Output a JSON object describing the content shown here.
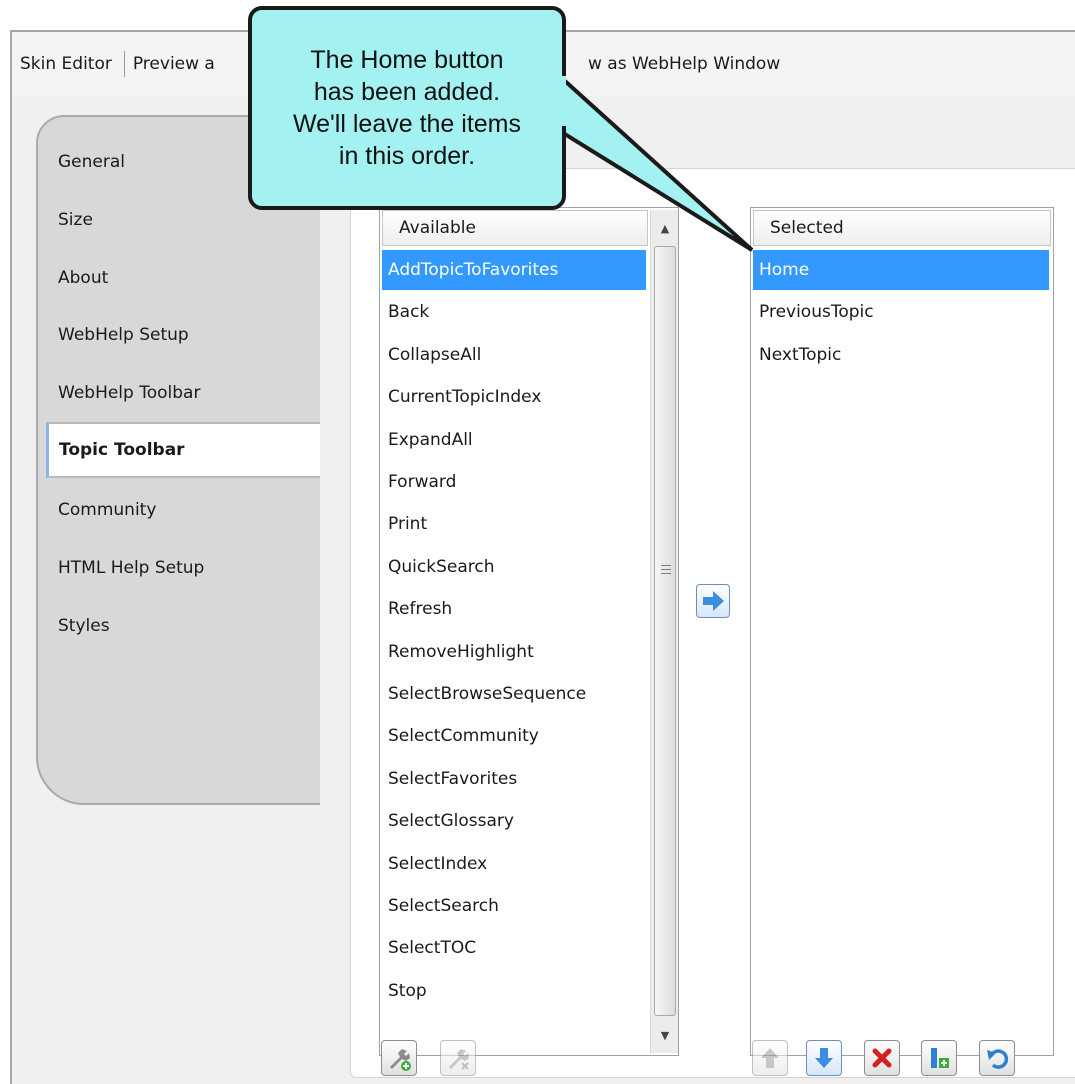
{
  "toolbar": {
    "skin_editor_label": "Skin Editor",
    "preview_label": "Preview a",
    "preview_window_label": "w as WebHelp Window"
  },
  "tabs": [
    {
      "label": "General"
    },
    {
      "label": "Size"
    },
    {
      "label": "About"
    },
    {
      "label": "WebHelp Setup"
    },
    {
      "label": "WebHelp Toolbar"
    },
    {
      "label": "Topic Toolbar",
      "active": true
    },
    {
      "label": "Community"
    },
    {
      "label": "HTML Help Setup"
    },
    {
      "label": "Styles"
    }
  ],
  "available": {
    "header": "Available",
    "items": [
      "AddTopicToFavorites",
      "Back",
      "CollapseAll",
      "CurrentTopicIndex",
      "ExpandAll",
      "Forward",
      "Print",
      "QuickSearch",
      "Refresh",
      "RemoveHighlight",
      "SelectBrowseSequence",
      "SelectCommunity",
      "SelectFavorites",
      "SelectGlossary",
      "SelectIndex",
      "SelectSearch",
      "SelectTOC",
      "Stop"
    ],
    "selected_index": 0
  },
  "selected": {
    "header": "Selected",
    "items": [
      "Home",
      "PreviousTopic",
      "NextTopic"
    ],
    "selected_index": 0
  },
  "icons": {
    "add_arrow": "right-arrow-icon",
    "new_item": "wrench-add-icon",
    "remove_item": "wrench-remove-icon",
    "move_up": "arrow-up-icon",
    "move_down": "arrow-down-icon",
    "delete": "red-x-icon",
    "add_separator": "separator-add-icon",
    "reset": "undo-icon"
  },
  "colors": {
    "selection": "#3399ff",
    "callout_fill": "#a3f2f1",
    "active_tab_accent": "#8ab4e8"
  },
  "callout": {
    "text": "The Home button\nhas been added.\nWe'll leave the items\nin this order."
  }
}
